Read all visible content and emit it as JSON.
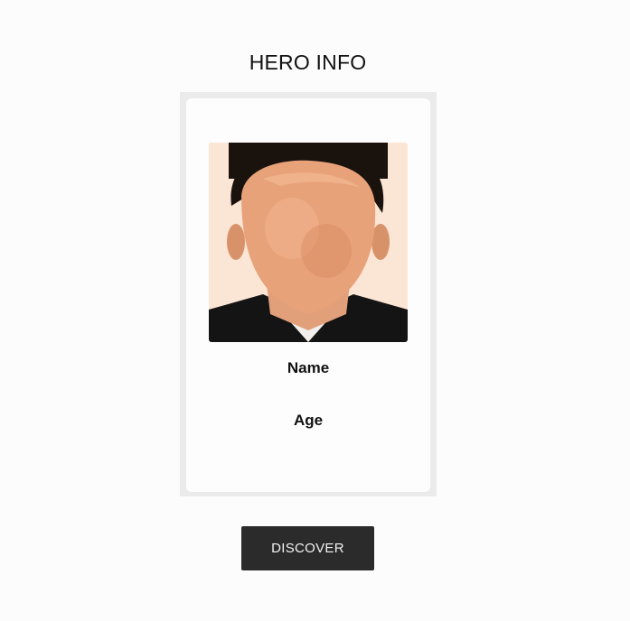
{
  "header": {
    "title": "HERO INFO"
  },
  "card": {
    "portrait_icon": "portrait-photo",
    "name_label": "Name",
    "age_label": "Age"
  },
  "actions": {
    "discover_label": "DISCOVER"
  },
  "colors": {
    "background": "#fcfcfc",
    "card_border": "#ebebeb",
    "button": "#2b2b2b",
    "button_text": "#f2f2f2"
  }
}
